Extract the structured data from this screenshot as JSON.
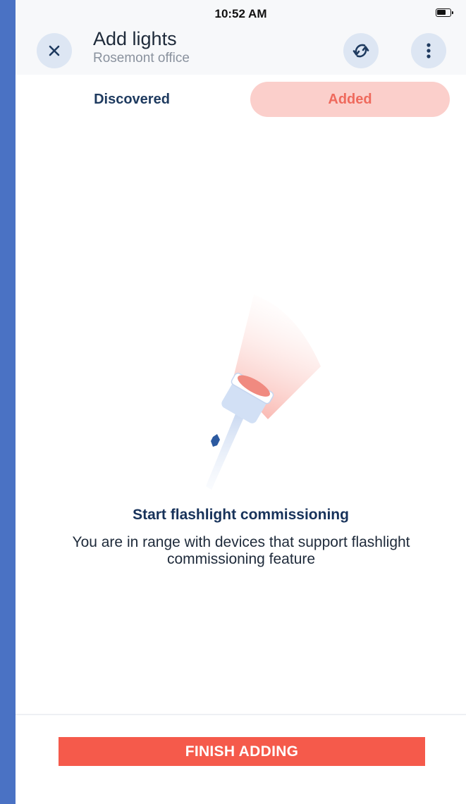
{
  "status_bar": {
    "time": "10:52 AM"
  },
  "header": {
    "title": "Add lights",
    "subtitle": "Rosemont office",
    "close_icon": "close-icon",
    "refresh_icon": "refresh-icon",
    "more_icon": "more-vertical-icon"
  },
  "tabs": [
    {
      "label": "Discovered",
      "selected": false
    },
    {
      "label": "Added",
      "selected": true
    }
  ],
  "empty_state": {
    "illustration": "flashlight-illustration",
    "heading": "Start flashlight commissioning",
    "description": "You are in range with devices that support flashlight commissioning feature"
  },
  "footer": {
    "finish_label": "FINISH ADDING"
  },
  "colors": {
    "accent": "#f55a4b",
    "tab_active_bg": "#fbcfcb",
    "tab_active_text": "#ef6a5d",
    "heading": "#17325a",
    "icon_bg": "#dde6f3"
  }
}
